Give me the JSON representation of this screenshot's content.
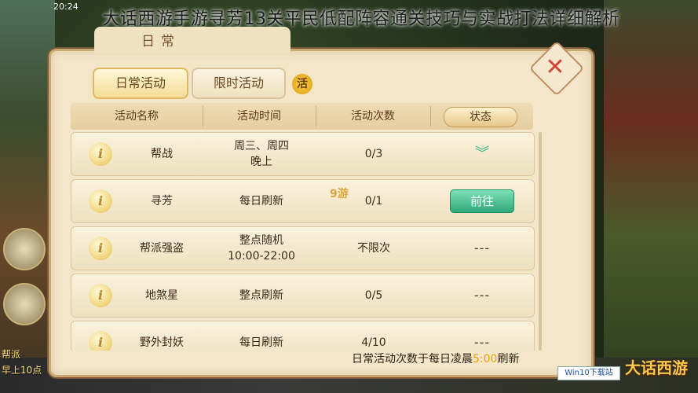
{
  "page_title": "大话西游手游寻芳13关平民低配阵容通关技巧与实战打法详细解析",
  "clock": "20:24",
  "left_side": {
    "label_faction": "帮派",
    "label_morning": "早上10点"
  },
  "panel": {
    "title": "日常",
    "close_label": "✕",
    "tabs": [
      {
        "label": "日常活动"
      },
      {
        "label": "限时活动"
      }
    ],
    "tab_icon": "活"
  },
  "table": {
    "headers": {
      "name": "活动名称",
      "time": "活动时间",
      "count": "活动次数",
      "status": "状态"
    },
    "rows": [
      {
        "icon": "i",
        "name": "帮战",
        "time_line1": "周三、周四",
        "time_line2": "晚上",
        "count": "0/3",
        "status": "check"
      },
      {
        "icon": "i",
        "name": "寻芳",
        "time_line1": "每日刷新",
        "time_line2": "",
        "count": "0/1",
        "status": "前往"
      },
      {
        "icon": "i",
        "name": "帮派强盗",
        "time_line1": "整点随机",
        "time_line2": "10:00-22:00",
        "count": "不限次",
        "status": "---"
      },
      {
        "icon": "i",
        "name": "地煞星",
        "time_line1": "整点刷新",
        "time_line2": "",
        "count": "0/5",
        "status": "---"
      },
      {
        "icon": "i",
        "name": "野外封妖",
        "time_line1": "每日刷新",
        "time_line2": "",
        "count": "4/10",
        "status": "---"
      }
    ]
  },
  "footer": {
    "note_before": "日常活动次数于每日凌晨",
    "note_time": "5:00",
    "note_after": "刷新"
  },
  "watermark": "9游",
  "brand": {
    "logo_text": "大话西游",
    "site_badge": "Win10下载站"
  },
  "colors": {
    "panel_bg": "#f3e6c9",
    "go_button": "#2fa77a",
    "highlight": "#e89f10",
    "close_x": "#d0473a"
  }
}
